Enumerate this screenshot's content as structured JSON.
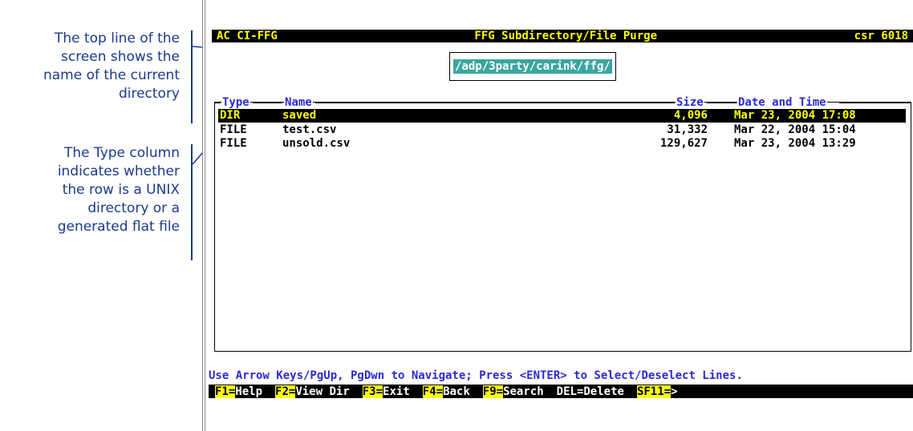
{
  "annotations": {
    "top": [
      "The top line of the",
      "screen shows the",
      "name of the current",
      "directory"
    ],
    "type": [
      "The Type column",
      "indicates whether",
      "the row is a UNIX",
      "directory or a",
      "generated flat file"
    ]
  },
  "terminal": {
    "title_left": "AC CI-FFG",
    "title_center": "FFG Subdirectory/File Purge",
    "title_right": "csr 6018",
    "path": "/adp/3party/carink/ffg/",
    "columns": {
      "type": "Type",
      "name": "Name",
      "size": "Size",
      "date": "Date and Time"
    },
    "rows": [
      {
        "type": "DIR",
        "name": "saved",
        "size": "4,096",
        "date": "Mar 23, 2004 17:08",
        "selected": true
      },
      {
        "type": "FILE",
        "name": "test.csv",
        "size": "31,332",
        "date": "Mar 22, 2004 15:04",
        "selected": false
      },
      {
        "type": "FILE",
        "name": "unsold.csv",
        "size": "129,627",
        "date": "Mar 23, 2004 13:29",
        "selected": false
      }
    ],
    "help": "Use Arrow Keys/PgUp, PgDwn to Navigate; Press <ENTER> to Select/Deselect Lines.",
    "fkeys": [
      {
        "key": "F1=",
        "label": "Help"
      },
      {
        "key": "F2=",
        "label": "View Dir"
      },
      {
        "key": "F3=",
        "label": "Exit"
      },
      {
        "key": "F4=",
        "label": "Back"
      },
      {
        "key": "F9=",
        "label": "Search"
      },
      {
        "key": "DEL=",
        "label": "Delete"
      },
      {
        "key": "SF11=",
        "label": ">"
      }
    ]
  },
  "colors": {
    "title_bg": "#000000",
    "title_fg": "#ffff00",
    "path_bg": "#3aa6a0",
    "header_fg": "#2b2bd4",
    "annotation": "#1a3a8c"
  }
}
